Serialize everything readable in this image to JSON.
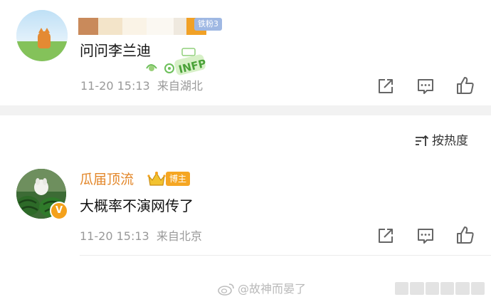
{
  "comment_1": {
    "fan_badge": "铁粉3",
    "text": "问问李兰迪",
    "sticker_text": "INFP",
    "time": "11-20 15:13",
    "location": "来自湖北"
  },
  "sort": {
    "label": "按热度"
  },
  "comment_2": {
    "username": "瓜届顶流",
    "role_badge": "博主",
    "verified_mark": "V",
    "text": "大概率不演网传了",
    "time": "11-20 15:13",
    "location": "来自北京"
  },
  "watermark": {
    "text": "@故神而晏了"
  },
  "colors": {
    "username_orange": "#e3872a",
    "meta_gray": "#999999",
    "badge_blue": "#9fb8e3",
    "badge_orange": "#f5a623"
  },
  "icons": [
    "share-icon",
    "comment-icon",
    "like-icon",
    "sort-icon",
    "weibo-logo-icon",
    "crown-icon"
  ]
}
